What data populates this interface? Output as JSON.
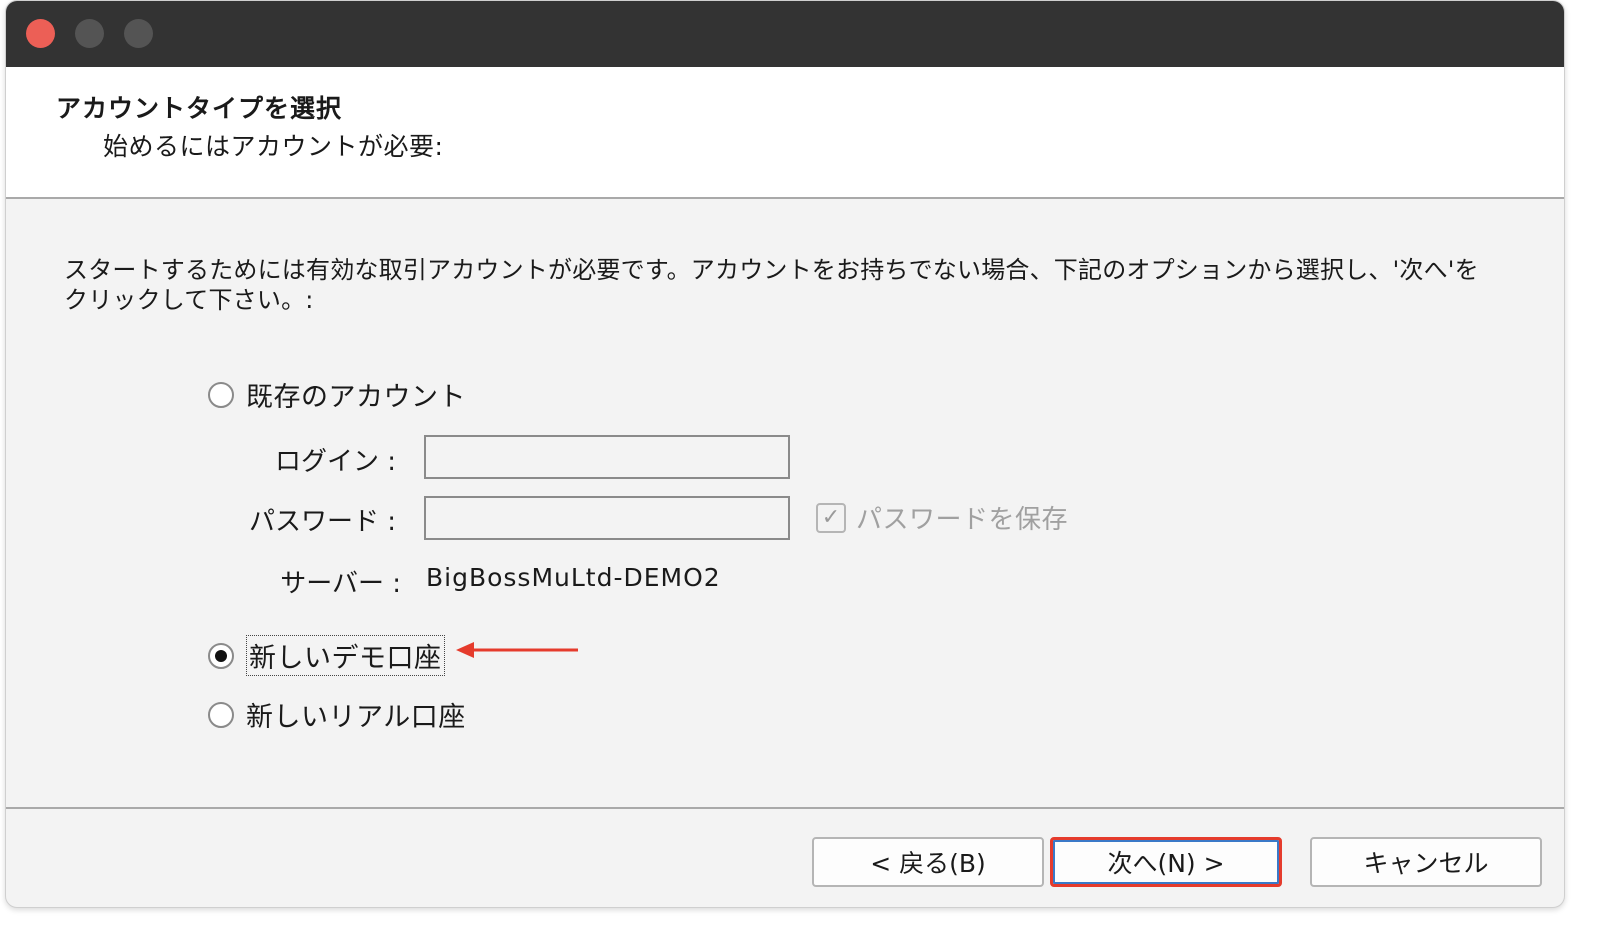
{
  "dialog": {
    "header_title": "アカウントタイプを選択",
    "header_subtitle": "始めるにはアカウントが必要:",
    "instruction": "スタートするためには有効な取引アカウントが必要です。アカウントをお持ちでない場合、下記のオプションから選択し、'次へ'をクリックして下さい。:"
  },
  "options": {
    "existing_account": {
      "label": "既存のアカウント",
      "selected": false
    },
    "new_demo": {
      "label": "新しいデモ口座",
      "selected": true
    },
    "new_real": {
      "label": "新しいリアル口座",
      "selected": false
    }
  },
  "fields": {
    "login_label": "ログイン :",
    "login_value": "",
    "password_label": "パスワード :",
    "password_value": "",
    "save_password_label": "パスワードを保存",
    "save_password_checked": true,
    "server_label": "サーバー :",
    "server_value": "BigBossMuLtd-DEMO2"
  },
  "buttons": {
    "back": "< 戻る(B)",
    "next": "次へ(N) >",
    "cancel": "キャンセル"
  },
  "annotation_color": "#e53b2c"
}
